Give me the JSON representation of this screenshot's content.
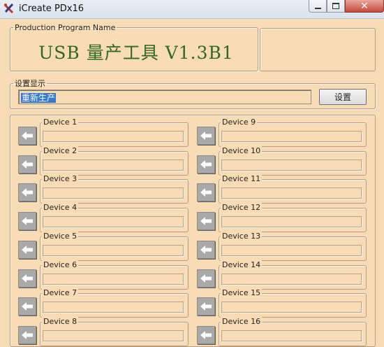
{
  "window": {
    "title": "iCreate PDx16",
    "icon": "tools-icon",
    "controls": [
      "minimize-icon",
      "maximize-icon",
      "close-icon"
    ]
  },
  "program": {
    "group_label": "Production Program Name",
    "name": "USB 量产工具 V1.3B1"
  },
  "settings": {
    "group_label": "设置显示",
    "value": "重新生产",
    "button_label": "设置"
  },
  "devices": {
    "left": [
      {
        "label": "Device 1"
      },
      {
        "label": "Device 2"
      },
      {
        "label": "Device 3"
      },
      {
        "label": "Device 4"
      },
      {
        "label": "Device 5"
      },
      {
        "label": "Device 6"
      },
      {
        "label": "Device 7"
      },
      {
        "label": "Device 8"
      }
    ],
    "right": [
      {
        "label": "Device 9"
      },
      {
        "label": "Device 10"
      },
      {
        "label": "Device 11"
      },
      {
        "label": "Device 12"
      },
      {
        "label": "Device 13"
      },
      {
        "label": "Device 14"
      },
      {
        "label": "Device 15"
      },
      {
        "label": "Device 16"
      }
    ]
  },
  "colors": {
    "background": "#f7dcb5",
    "program_text": "#2f6a1e",
    "selection": "#3378d2",
    "arrow_button": "#a9a9a9"
  }
}
